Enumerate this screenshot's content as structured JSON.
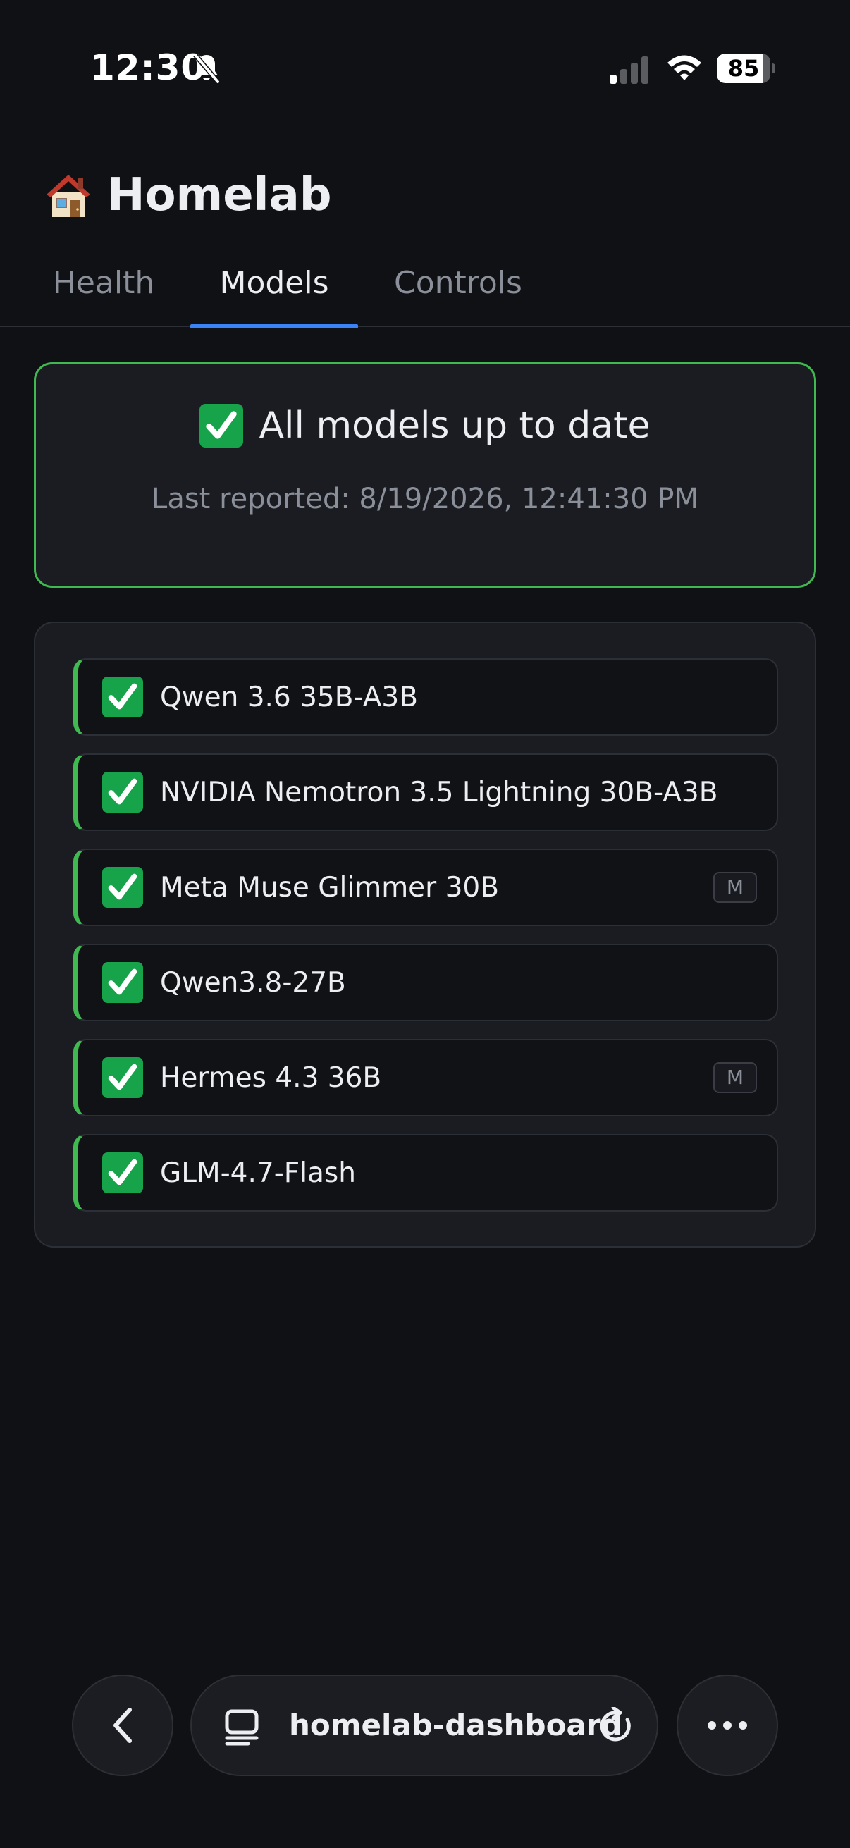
{
  "status_bar": {
    "time": "12:30",
    "battery": "85",
    "battery_level": 0.85
  },
  "header": {
    "icon": "house-icon",
    "title": "Homelab"
  },
  "tabs": [
    {
      "label": "Health",
      "active": false
    },
    {
      "label": "Models",
      "active": true
    },
    {
      "label": "Controls",
      "active": false
    }
  ],
  "summary": {
    "title": "All models up to date",
    "meta": "Last reported: 8/19/2026, 12:41:30 PM",
    "status_color": "#3fb950"
  },
  "models": [
    {
      "name": "Qwen 3.6 35B-A3B",
      "badge": ""
    },
    {
      "name": "NVIDIA Nemotron 3.5 Lightning 30B-A3B",
      "badge": ""
    },
    {
      "name": "Meta Muse Glimmer 30B",
      "badge": "M"
    },
    {
      "name": "Qwen3.8-27B",
      "badge": ""
    },
    {
      "name": "Hermes 4.3 36B",
      "badge": "M"
    },
    {
      "name": "GLM-4.7-Flash",
      "badge": ""
    }
  ],
  "browser": {
    "url": "homelab-dashboard",
    "accent": "#3b82f6"
  }
}
